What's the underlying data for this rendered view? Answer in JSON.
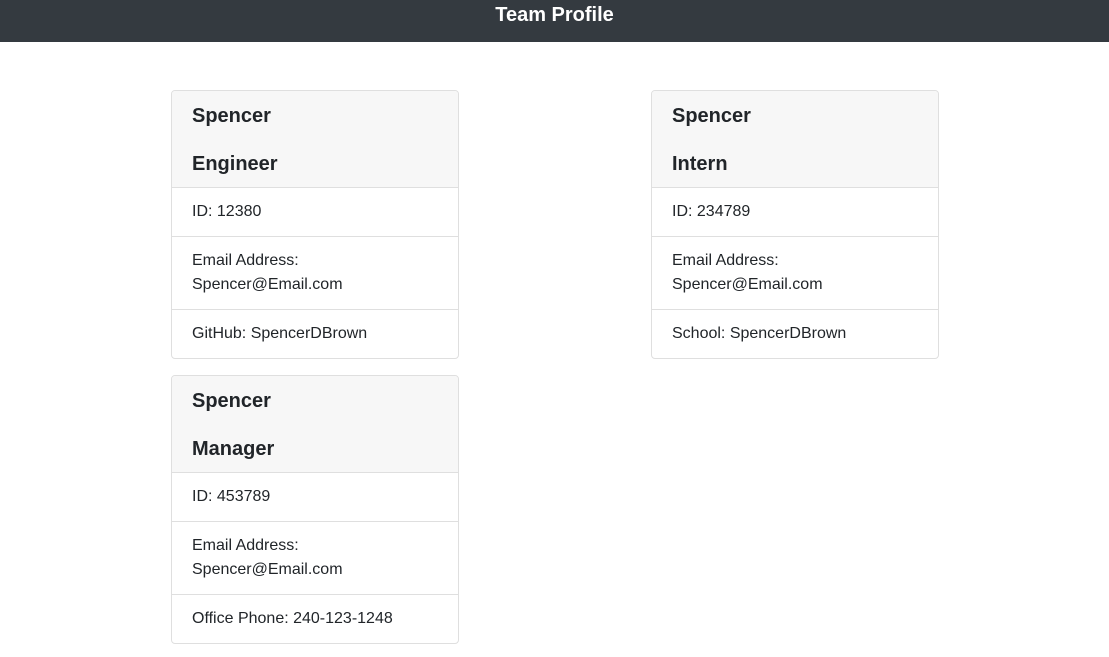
{
  "header": {
    "title": "Team Profile"
  },
  "cards": [
    {
      "name": "Spencer",
      "role": "Engineer",
      "id": "ID: 12380",
      "email_label": "Email Address:",
      "email": "Spencer@Email.com",
      "extra": "GitHub: SpencerDBrown"
    },
    {
      "name": "Spencer",
      "role": "Intern",
      "id": "ID: 234789",
      "email_label": "Email Address:",
      "email": "Spencer@Email.com",
      "extra": "School: SpencerDBrown"
    },
    {
      "name": "Spencer",
      "role": "Manager",
      "id": "ID: 453789",
      "email_label": "Email Address:",
      "email": "Spencer@Email.com",
      "extra": "Office Phone: 240-123-1248"
    }
  ],
  "colors": {
    "navbar_bg": "#343a40",
    "card_header_bg": "#f7f7f7",
    "border": "#dfdfdf"
  }
}
